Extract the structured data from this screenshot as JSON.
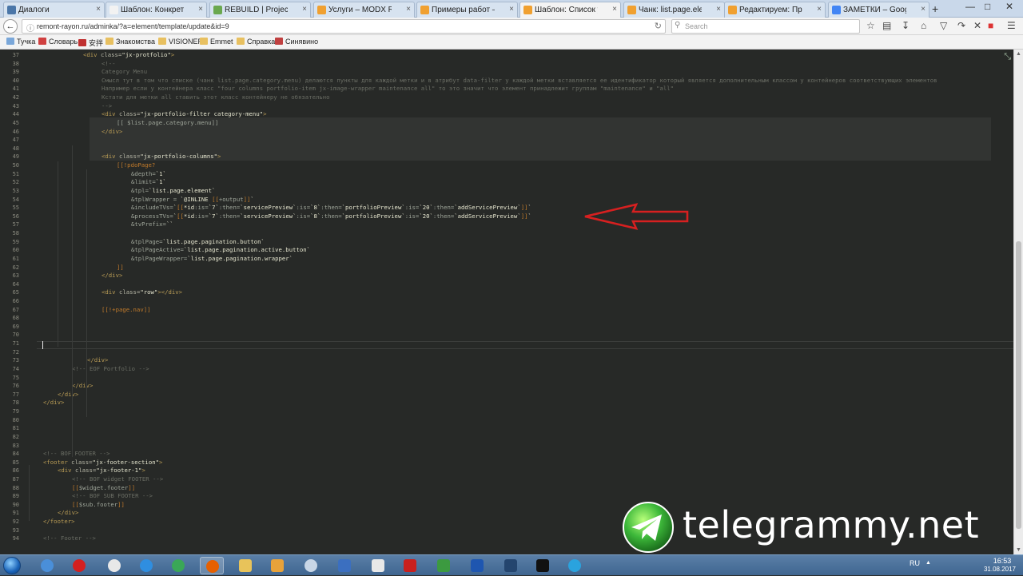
{
  "browser": {
    "tabs": [
      {
        "label": "Диалоги",
        "favicon_color": "#4a76a8",
        "active": false
      },
      {
        "label": "Шаблон: Конкретная Услуга",
        "favicon_color": "#f2f2f2",
        "active": false
      },
      {
        "label": "REBUILD | Projects",
        "favicon_color": "#6aa84f",
        "active": false
      },
      {
        "label": "Услуги – MODX Revolution",
        "favicon_color": "#f0a030",
        "active": false
      },
      {
        "label": "Примеры работ – MODX",
        "favicon_color": "#f0a030",
        "active": false
      },
      {
        "label": "Шаблон: Список услуг | MODX",
        "favicon_color": "#f0a030",
        "active": true
      },
      {
        "label": "Чанк: list.page.element | MODX",
        "favicon_color": "#f0a030",
        "active": false
      },
      {
        "label": "Редактируем: Примеры работ",
        "favicon_color": "#f0a030",
        "active": false
      },
      {
        "label": "ЗАМЕТКИ – Google Docs",
        "favicon_color": "#4285f4",
        "active": false
      }
    ],
    "new_tab": "+",
    "url": "remont-rayon.ru/adminka/?a=element/template/update&id=9",
    "search_placeholder": "Search",
    "bookmarks": [
      {
        "label": "Тучка",
        "icon_color": "#7aa7d9"
      },
      {
        "label": "Словарь",
        "icon_color": "#d04040"
      },
      {
        "label": "安拌",
        "icon_color": "#c03030"
      },
      {
        "label": "Знакомства",
        "icon_color": "#e8c060"
      },
      {
        "label": "VISIONER",
        "icon_color": "#e8c060"
      },
      {
        "label": "Emmet",
        "icon_color": "#e8c060"
      },
      {
        "label": "Справка",
        "icon_color": "#e8c060"
      },
      {
        "label": "Синявино",
        "icon_color": "#c04040"
      }
    ]
  },
  "editor": {
    "lines": [
      {
        "n": "37",
        "html": "<span class=\"tg\">&lt;div</span> <span class=\"at\">class=</span><span class=\"st\">\"jx-protfolio\"</span><span class=\"tg\">&gt;</span>",
        "indent": 50
      },
      {
        "n": "38",
        "html": "<span class=\"cm\">&lt;!--</span>",
        "indent": 73
      },
      {
        "n": "39",
        "html": "<span class=\"cm\">Category Menu</span>",
        "indent": 73
      },
      {
        "n": "40",
        "html": "<span class=\"cm\">Смысл тут в том что списке (чанк list.page.category.menu) делаются пункты для каждой метки и в атрибут data-filter у каждой метки вставляется ее идентификатор который является дополнительным классом у контейнеров соответствующих элементов</span>",
        "indent": 73
      },
      {
        "n": "41",
        "html": "<span class=\"cm\">Например если у контейнера класс \"four columns portfolio-item jx-image-wrapper maintenance all\" то это значит что элемент принадлежит группам \"maintenance\" и \"all\"</span>",
        "indent": 73
      },
      {
        "n": "42",
        "html": "<span class=\"cm\">Кстати для метки all ставить этот класс контейнеру не обязательно</span>",
        "indent": 73
      },
      {
        "n": "43",
        "html": "<span class=\"cm\">--&gt;</span>",
        "indent": 73
      },
      {
        "n": "44",
        "html": "<span class=\"tg\">&lt;div</span> <span class=\"at\">class=</span><span class=\"st\">\"jx-portfolio-filter category-menu\"</span><span class=\"tg\">&gt;</span>",
        "indent": 73
      },
      {
        "n": "45",
        "html": "<span class=\"ph\">[[ $list.page.category.menu]]</span>",
        "indent": 92
      },
      {
        "n": "46",
        "html": "<span class=\"tg\">&lt;/div&gt;</span>",
        "indent": 73
      },
      {
        "n": "47",
        "html": "",
        "indent": 0
      },
      {
        "n": "48",
        "html": "",
        "indent": 0
      },
      {
        "n": "49",
        "html": "<span class=\"tg\">&lt;div</span> <span class=\"at\">class=</span><span class=\"st\">\"jx-portfolio-columns\"</span><span class=\"tg\">&gt;</span>",
        "indent": 73
      },
      {
        "n": "50",
        "html": "<span class=\"mx\">[[!pdoPage?</span>",
        "indent": 92
      },
      {
        "n": "51",
        "html": "<span class=\"ph\">&amp;depth=</span><span class=\"bt\">`1`</span>",
        "indent": 110
      },
      {
        "n": "52",
        "html": "<span class=\"ph\">&amp;limit=</span><span class=\"bt\">`1`</span>",
        "indent": 110
      },
      {
        "n": "53",
        "html": "<span class=\"ph\">&amp;tpl=</span><span class=\"bt\">`list.page.element`</span>",
        "indent": 110
      },
      {
        "n": "54",
        "html": "<span class=\"ph\">&amp;tplWrapper = </span><span class=\"bt\">`@INLINE </span><span class=\"mx\">[[</span><span class=\"ph\">+output</span><span class=\"mx\">]]</span><span class=\"bt\">`</span>",
        "indent": 110
      },
      {
        "n": "55",
        "html": "<span class=\"ph\">&amp;includeTVs=</span><span class=\"bt\">`</span><span class=\"mx\">[[</span><span class=\"st\">*id</span><span class=\"ph\">:is=</span><span class=\"bt\">`7`</span><span class=\"ph\">:then=</span><span class=\"bt\">`servicePreview`</span><span class=\"ph\">:is=</span><span class=\"bt\">`8`</span><span class=\"ph\">:then=</span><span class=\"bt\">`portfolioPreview`</span><span class=\"ph\">:is=</span><span class=\"bt\">`20`</span><span class=\"ph\">:then=</span><span class=\"bt\">`addServicePreview`</span><span class=\"mx\">]]</span><span class=\"bt\">`</span>",
        "indent": 110
      },
      {
        "n": "56",
        "html": "<span class=\"ph\">&amp;processTVs=</span><span class=\"bt\">`</span><span class=\"mx\">[[</span><span class=\"st\">*id</span><span class=\"ph\">:is=</span><span class=\"bt\">`7`</span><span class=\"ph\">:then=</span><span class=\"bt\">`servicePreview`</span><span class=\"ph\">:is=</span><span class=\"bt\">`8`</span><span class=\"ph\">:then=</span><span class=\"bt\">`portfolioPreview`</span><span class=\"ph\">:is=</span><span class=\"bt\">`20`</span><span class=\"ph\">:then=</span><span class=\"bt\">`addServicePreview`</span><span class=\"mx\">]]</span><span class=\"bt\">`</span>",
        "indent": 110
      },
      {
        "n": "57",
        "html": "<span class=\"ph\">&amp;tvPrefix=</span><span class=\"bt\">``</span>",
        "indent": 110
      },
      {
        "n": "58",
        "html": "",
        "indent": 0
      },
      {
        "n": "59",
        "html": "<span class=\"ph\">&amp;tplPage=</span><span class=\"bt\">`list.page.pagination.button`</span>",
        "indent": 110
      },
      {
        "n": "60",
        "html": "<span class=\"ph\">&amp;tplPageActive=</span><span class=\"bt\">`list.page.pagination.active.button`</span>",
        "indent": 110
      },
      {
        "n": "61",
        "html": "<span class=\"ph\">&amp;tplPageWrapper=</span><span class=\"bt\">`list.page.pagination.wrapper`</span>",
        "indent": 110
      },
      {
        "n": "62",
        "html": "<span class=\"mx\">]]</span>",
        "indent": 92
      },
      {
        "n": "63",
        "html": "<span class=\"tg\">&lt;/div&gt;</span>",
        "indent": 73
      },
      {
        "n": "64",
        "html": "",
        "indent": 0
      },
      {
        "n": "65",
        "html": "<span class=\"tg\">&lt;div</span> <span class=\"at\">class=</span><span class=\"st\">\"row\"</span><span class=\"tg\">&gt;&lt;/div&gt;</span>",
        "indent": 73
      },
      {
        "n": "66",
        "html": "",
        "indent": 0
      },
      {
        "n": "67",
        "html": "<span class=\"mx\">[[!+page.nav]]</span>",
        "indent": 73
      },
      {
        "n": "68",
        "html": "",
        "indent": 0
      },
      {
        "n": "69",
        "html": "",
        "indent": 0
      },
      {
        "n": "70",
        "html": "",
        "indent": 0
      },
      {
        "n": "71",
        "html": "",
        "indent": 0
      },
      {
        "n": "72",
        "html": "",
        "indent": 0
      },
      {
        "n": "73",
        "html": "<span class=\"tg\">&lt;/div&gt;</span>",
        "indent": 55
      },
      {
        "n": "74",
        "html": "<span class=\"cm\">&lt;!-- EOF Portfolio --&gt;</span>",
        "indent": 36
      },
      {
        "n": "75",
        "html": "",
        "indent": 0
      },
      {
        "n": "76",
        "html": "<span class=\"tg\">&lt;/div&gt;</span>",
        "indent": 36
      },
      {
        "n": "77",
        "html": "<span class=\"tg\">&lt;/div&gt;</span>",
        "indent": 18
      },
      {
        "n": "78",
        "html": "<span class=\"tg\">&lt;/div&gt;</span>",
        "indent": 0
      },
      {
        "n": "79",
        "html": "",
        "indent": 0
      },
      {
        "n": "80",
        "html": "",
        "indent": 0
      },
      {
        "n": "81",
        "html": "",
        "indent": 0
      },
      {
        "n": "82",
        "html": "",
        "indent": 0
      },
      {
        "n": "83",
        "html": "",
        "indent": 0
      },
      {
        "n": "84",
        "html": "<span class=\"cm\">&lt;!-- BOF FOOTER --&gt;</span>",
        "indent": 0
      },
      {
        "n": "85",
        "html": "<span class=\"tg\">&lt;footer</span> <span class=\"at\">class=</span><span class=\"st\">\"jx-footer-section\"</span><span class=\"tg\">&gt;</span>",
        "indent": 0
      },
      {
        "n": "86",
        "html": "<span class=\"tg\">&lt;div</span> <span class=\"at\">class=</span><span class=\"st\">\"jx-footer-1\"</span><span class=\"tg\">&gt;</span>",
        "indent": 18
      },
      {
        "n": "87",
        "html": "<span class=\"cm\">&lt;!-- BOF widget FOOTER --&gt;</span>",
        "indent": 36
      },
      {
        "n": "88",
        "html": "<span class=\"mx\">[[</span><span class=\"ph\">$widget.footer</span><span class=\"mx\">]]</span>",
        "indent": 36
      },
      {
        "n": "89",
        "html": "<span class=\"cm\">&lt;!-- BOF SUB FOOTER --&gt;</span>",
        "indent": 36
      },
      {
        "n": "90",
        "html": "<span class=\"mx\">[[</span><span class=\"ph\">$sub.footer</span><span class=\"mx\">]]</span>",
        "indent": 36
      },
      {
        "n": "91",
        "html": "<span class=\"tg\">&lt;/div&gt;</span>",
        "indent": 18
      },
      {
        "n": "92",
        "html": "<span class=\"tg\">&lt;/footer&gt;</span>",
        "indent": 0
      },
      {
        "n": "93",
        "html": "",
        "indent": 0
      },
      {
        "n": "94",
        "html": "<span class=\"cm\">&lt;!-- Footer --&gt;</span>",
        "indent": 0
      }
    ]
  },
  "watermark": {
    "text": "telegrammy.net"
  },
  "taskbar": {
    "apps": [
      {
        "name": "chrome-old",
        "color": "#4a8fd9"
      },
      {
        "name": "opera",
        "color": "#d32020"
      },
      {
        "name": "yandex",
        "color": "#e8e8e8"
      },
      {
        "name": "ie",
        "color": "#2f8ee0"
      },
      {
        "name": "chrome",
        "color": "#3aa757"
      },
      {
        "name": "firefox",
        "color": "#e66000"
      },
      {
        "name": "explorer",
        "color": "#e8c35a"
      },
      {
        "name": "media",
        "color": "#e8a23a"
      },
      {
        "name": "cd",
        "color": "#c8d6e6"
      },
      {
        "name": "network",
        "color": "#3b6fc0"
      },
      {
        "name": "docs",
        "color": "#e8e8e8"
      },
      {
        "name": "filezilla",
        "color": "#c8201e"
      },
      {
        "name": "notepad",
        "color": "#3c9a40"
      },
      {
        "name": "calc",
        "color": "#1e56b0"
      },
      {
        "name": "connect",
        "color": "#24456e"
      },
      {
        "name": "terminal",
        "color": "#111111"
      },
      {
        "name": "telegram",
        "color": "#2aa3de"
      }
    ],
    "lang": "RU",
    "time": "16:53",
    "date": "31.08.2017"
  }
}
